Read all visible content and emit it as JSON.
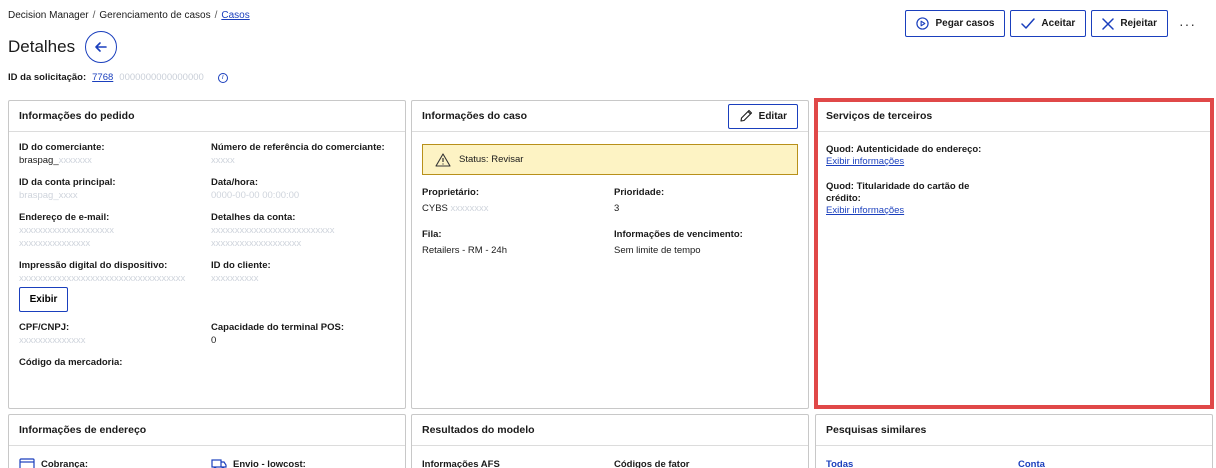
{
  "breadcrumb": {
    "item1": "Decision Manager",
    "item2": "Gerenciamento de casos",
    "item3": "Casos",
    "sep": "/"
  },
  "page": {
    "title": "Detalhes"
  },
  "request": {
    "label": "ID da solicitação:",
    "value": "7768",
    "value_blurred": "0000000000000000",
    "info": "i"
  },
  "actions": {
    "take": "Pegar casos",
    "accept": "Aceitar",
    "reject": "Rejeitar",
    "more": "···"
  },
  "order_info": {
    "title": "Informações do pedido",
    "merchant_id_label": "ID do comerciante:",
    "merchant_id_value": "braspag_",
    "merchant_id_blur": "xxxxxxx",
    "merchant_ref_label": "Número de referência do comerciante:",
    "merchant_ref_value": "xxxxx",
    "main_account_label": "ID da conta principal:",
    "main_account_value": "braspag_xxxx",
    "datetime_label": "Data/hora:",
    "datetime_value": "0000-00-00 00:00:00",
    "email_label": "Endereço de e-mail:",
    "email_value_1": "xxxxxxxxxxxxxxxxxxxx",
    "email_value_2": "xxxxxxxxxxxxxxx",
    "account_details_label": "Detalhes da conta:",
    "account_details_value_1": "xxxxxxxxxxxxxxxxxxxxxxxxxx",
    "account_details_value_2": "xxxxxxxxxxxxxxxxxxx",
    "device_label": "Impressão digital do dispositivo:",
    "device_value": "xxxxxxxxxxxxxxxxxxxxxxxxxxxxxxxxxxx",
    "client_id_label": "ID do cliente:",
    "client_id_value": "xxxxxxxxxx",
    "show_button": "Exibir",
    "cpf_label": "CPF/CNPJ:",
    "cpf_value": "xxxxxxxxxxxxxx",
    "pos_label": "Capacidade do terminal POS:",
    "pos_value": "0",
    "merch_code_label": "Código da mercadoria:"
  },
  "case_info": {
    "title": "Informações do caso",
    "edit": "Editar",
    "status": "Status: Revisar",
    "owner_label": "Proprietário:",
    "owner_value": "CYBS",
    "owner_blur": "xxxxxxxx",
    "priority_label": "Prioridade:",
    "priority_value": "3",
    "queue_label": "Fila:",
    "queue_value": "Retailers - RM - 24h",
    "due_label": "Informações de vencimento:",
    "due_value": "Sem limite de tempo"
  },
  "third_party": {
    "title": "Serviços de terceiros",
    "item1_label": "Quod: Autenticidade do endereço:",
    "item1_link": "Exibir informações",
    "item2_label_1": "Quod: Titularidade do cartão de",
    "item2_label_2": "crédito:",
    "item2_link": "Exibir informações"
  },
  "address_info": {
    "title": "Informações de endereço",
    "billing": "Cobrança:",
    "shipping": "Envio - lowcost:"
  },
  "model_results": {
    "title": "Resultados do modelo",
    "afs": "Informações AFS",
    "factor_codes": "Códigos de fator"
  },
  "similar_searches": {
    "title": "Pesquisas similares",
    "all": "Todas",
    "account": "Conta"
  },
  "colors": {
    "accent": "#1a3fbd",
    "highlight": "#e04848",
    "status_bg": "#fdf3c4"
  }
}
